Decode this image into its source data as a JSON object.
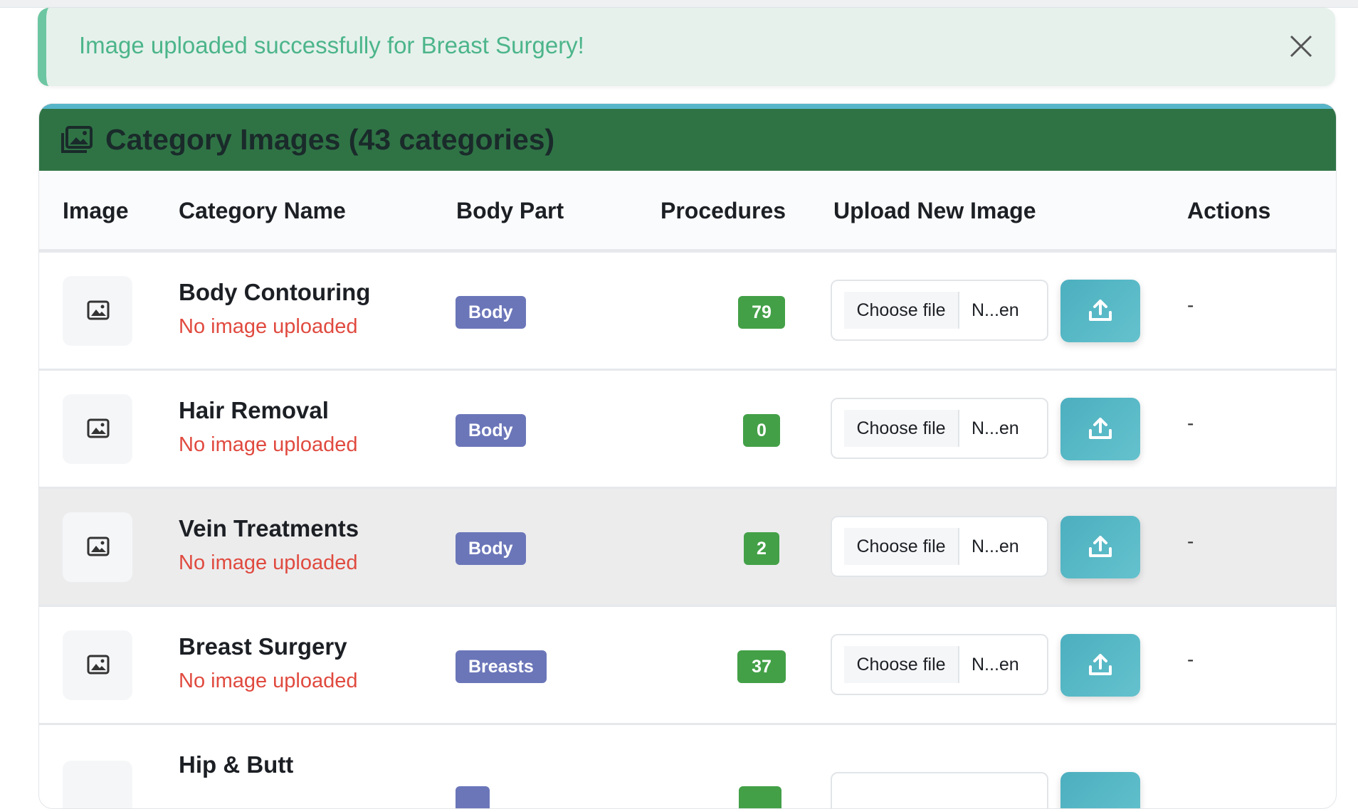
{
  "alert": {
    "message": "Image uploaded successfully for Breast Surgery!",
    "close_icon": "close-icon"
  },
  "card": {
    "title": "Category Images (43 categories)",
    "icon": "images-icon",
    "header_color": "#2f7345",
    "accent_color": "#57b5c9"
  },
  "table": {
    "columns": [
      "Image",
      "Category Name",
      "Body Part",
      "Procedures",
      "Upload New Image",
      "Actions"
    ],
    "rows": [
      {
        "name": "Body Contouring",
        "status": "No image uploaded",
        "body_part": "Body",
        "procedures": "79",
        "file_button": "Choose file",
        "file_name": "N...en",
        "actions": "-"
      },
      {
        "name": "Hair Removal",
        "status": "No image uploaded",
        "body_part": "Body",
        "procedures": "0",
        "file_button": "Choose file",
        "file_name": "N...en",
        "actions": "-"
      },
      {
        "name": "Vein Treatments",
        "status": "No image uploaded",
        "body_part": "Body",
        "procedures": "2",
        "file_button": "Choose file",
        "file_name": "N...en",
        "actions": "-"
      },
      {
        "name": "Breast Surgery",
        "status": "No image uploaded",
        "body_part": "Breasts",
        "procedures": "37",
        "file_button": "Choose file",
        "file_name": "N...en",
        "actions": "-"
      },
      {
        "name": "Hip & Butt",
        "status": "",
        "body_part": "",
        "procedures": "",
        "file_button": "",
        "file_name": "",
        "actions": ""
      }
    ]
  },
  "colors": {
    "success_text": "#4cb58a",
    "error_text": "#e04a3f",
    "badge_body": "#6b76b9",
    "badge_count": "#43a047",
    "upload_button": "#4cafbf"
  }
}
